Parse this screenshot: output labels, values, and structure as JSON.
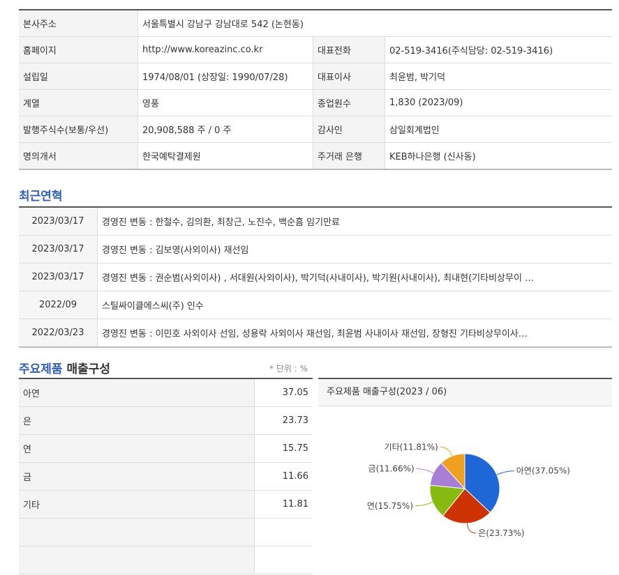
{
  "company_info": {
    "rows": [
      {
        "label": "본사주소",
        "value": "서울특별시 강남구 강남대로 542 (논현동)"
      },
      {
        "label": "홈페이지",
        "value": "http://www.koreazinc.co.kr",
        "label2": "대표전화",
        "value2": "02-519-3416(주식담당: 02-519-3416)"
      },
      {
        "label": "설립일",
        "value": "1974/08/01 (상장일: 1990/07/28)",
        "label2": "대표이사",
        "value2": "최윤범, 박기덕"
      },
      {
        "label": "계열",
        "value": "영풍",
        "label2": "종업원수",
        "value2": "1,830 (2023/09)"
      },
      {
        "label": "발행주식수(보통/우선)",
        "value": "20,908,588 주 / 0 주",
        "label2": "감사인",
        "value2": "삼일회계법인"
      },
      {
        "label": "명의개서",
        "value": "한국예탁결제원",
        "label2": "주거래 은행",
        "value2": "KEB하나은행 (신사동)"
      }
    ]
  },
  "history": {
    "title": "최근연혁",
    "items": [
      {
        "date": "2023/03/17",
        "text": "경영진 변동 : 한철수, 김의환, 최창근, 노진수, 백순흠 임기만료"
      },
      {
        "date": "2023/03/17",
        "text": "경영진 변동 : 김보영(사외이사) 재선임"
      },
      {
        "date": "2023/03/17",
        "text": "경영진 변동 : 권순범(사외이사) , 서대원(사외이사), 박기덕(사내이사), 박기원(사내이사), 최내현(기타비상무이 …"
      },
      {
        "date": "2022/09",
        "text": "스틸싸이클에스씨(주) 인수"
      },
      {
        "date": "2022/03/23",
        "text": "경영진 변동 : 이민호 사외이사 선임, 성용락 사외이사 재선임, 최윤범 사내이사 재선임, 장형진 기타비상무이사…"
      }
    ]
  },
  "products": {
    "title_blue": "주요제품",
    "title_dark": "매출구성",
    "unit": "* 단위 : %",
    "rows": [
      {
        "name": "아연",
        "value": "37.05"
      },
      {
        "name": "은",
        "value": "23.73"
      },
      {
        "name": "연",
        "value": "15.75"
      },
      {
        "name": "금",
        "value": "11.66"
      },
      {
        "name": "기타",
        "value": "11.81"
      },
      {
        "name": "",
        "value": ""
      },
      {
        "name": "",
        "value": ""
      }
    ]
  },
  "chart_data": {
    "type": "pie",
    "title": "주요제품 매출구성(2023 / 06)",
    "slices": [
      {
        "name": "아연",
        "value": 37.05,
        "label": "아연(37.05%)",
        "color": "#1f66d6"
      },
      {
        "name": "은",
        "value": 23.73,
        "label": "은(23.73%)",
        "color": "#cc3300"
      },
      {
        "name": "연",
        "value": 15.75,
        "label": "연(15.75%)",
        "color": "#88bb11"
      },
      {
        "name": "금",
        "value": 11.66,
        "label": "금(11.66%)",
        "color": "#a97fd6"
      },
      {
        "name": "기타",
        "value": 11.81,
        "label": "기타(11.81%)",
        "color": "#f0a020"
      }
    ]
  }
}
